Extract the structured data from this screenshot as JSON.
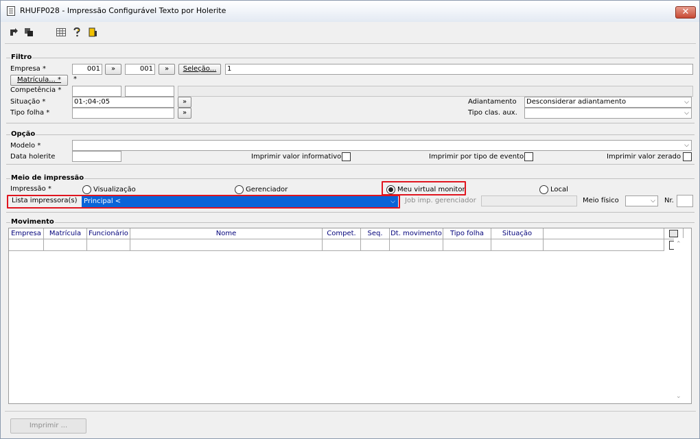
{
  "window": {
    "title": "RHUFP028 - Impressão Configurável Texto por Holerite",
    "close_glyph": "✕"
  },
  "toolbar": {
    "icons": [
      "arrow-right-icon",
      "copy-icon",
      "grid-icon",
      "help-icon",
      "exit-icon"
    ]
  },
  "filtro": {
    "title": "Filtro",
    "empresa_label": "Empresa *",
    "empresa_from": "001",
    "empresa_to": "001",
    "range_btn": "»",
    "selecao_btn": "Seleção...",
    "selecao_value": "1",
    "matricula_btn": "Matrícula... *",
    "matricula_value": "*",
    "competencia_label": "Competência *",
    "situacao_label": "Situação *",
    "situacao_value": "01-;04-;05",
    "tipo_folha_label": "Tipo folha *",
    "adiantamento_label": "Adiantamento",
    "adiantamento_value": "Desconsiderar adiantamento",
    "tipo_clas_label": "Tipo clas. aux."
  },
  "opcao": {
    "title": "Opção",
    "modelo_label": "Modelo *",
    "data_holerite_label": "Data holerite",
    "imprimir_informativo": "Imprimir valor informativo",
    "imprimir_tipo_evento": "Imprimir por tipo de evento",
    "imprimir_zerado": "Imprimir valor zerado"
  },
  "meio": {
    "title": "Meio de impressão",
    "impressao_label": "Impressão *",
    "opt_visualizacao": "Visualização",
    "opt_gerenciador": "Gerenciador",
    "opt_virtual": "Meu virtual monitor",
    "opt_local": "Local",
    "selected": "Meu virtual monitor",
    "lista_label": "Lista impressora(s)",
    "lista_value": "Principal <",
    "job_label": "Job imp. gerenciador",
    "meio_fisico_label": "Meio físico",
    "nr_label": "Nr."
  },
  "movimento": {
    "title": "Movimento",
    "columns": [
      "Empresa",
      "Matrícula",
      "Funcionário",
      "Nome",
      "Compet.",
      "Seq.",
      "Dt. movimento",
      "Tipo folha",
      "Situação"
    ]
  },
  "footer": {
    "imprimir_btn": "Imprimir ..."
  },
  "colors": {
    "highlight": "#e0141e",
    "selection": "#0a64d8",
    "header_text": "#00007a"
  }
}
